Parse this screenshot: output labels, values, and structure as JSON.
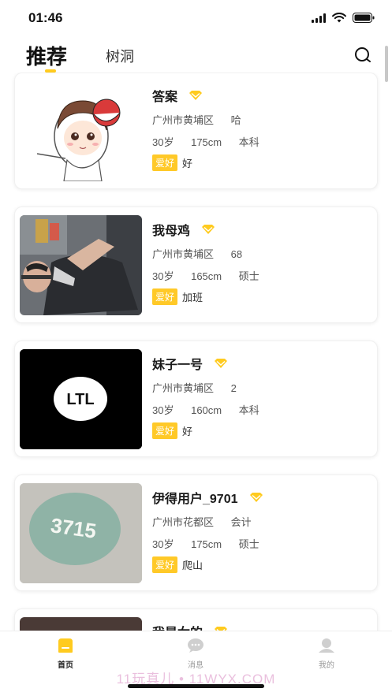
{
  "status_bar": {
    "time": "01:46"
  },
  "header": {
    "tabs": [
      "推荐",
      "树洞"
    ]
  },
  "profiles": [
    {
      "name": "答案",
      "location": "广州市黄埔区",
      "occupation": "哈",
      "age": "30岁",
      "height": "175cm",
      "education": "本科",
      "hobby_tag": "爱好",
      "hobby": "好"
    },
    {
      "name": "我母鸡",
      "location": "广州市黄埔区",
      "occupation": "68",
      "age": "30岁",
      "height": "165cm",
      "education": "硕士",
      "hobby_tag": "爱好",
      "hobby": "加班"
    },
    {
      "name": "妹子一号",
      "location": "广州市黄埔区",
      "occupation": "2",
      "age": "30岁",
      "height": "160cm",
      "education": "本科",
      "hobby_tag": "爱好",
      "hobby": "好",
      "thumb_text": "LTL"
    },
    {
      "name": "伊得用户_9701",
      "location": "广州市花都区",
      "occupation": "会计",
      "age": "30岁",
      "height": "175cm",
      "education": "硕士",
      "hobby_tag": "爱好",
      "hobby": "爬山",
      "thumb_text": "3715"
    },
    {
      "name": "我是女的"
    }
  ],
  "tabbar": {
    "items": [
      "首页",
      "消息",
      "我的"
    ]
  },
  "watermark": "11玩真儿 • 11WYX.COM",
  "colors": {
    "accent": "#ffcb1f",
    "hobby_tag": "#ffc928"
  }
}
